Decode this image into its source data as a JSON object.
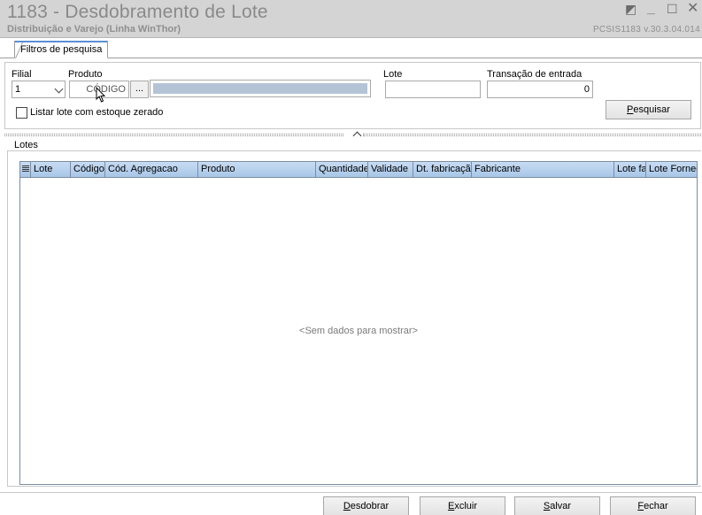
{
  "window": {
    "title": "1183 - Desdobramento de Lote",
    "subtitle": "Distribuição e Varejo (Linha WinThor)",
    "version": "PCSIS1183  v.30.3.04.014"
  },
  "tabs": [
    {
      "label": "Filtros de pesquisa"
    }
  ],
  "filters": {
    "filial_label": "Filial",
    "filial_value": "1",
    "produto_label": "Produto",
    "produto_code_placeholder": "CÓDIGO",
    "produto_lookup_label": "...",
    "lote_label": "Lote",
    "lote_value": "",
    "transacao_label": "Transação de entrada",
    "transacao_value": "0",
    "estoque_zerado_label": "Listar lote com estoque zerado",
    "estoque_zerado_checked": false,
    "pesquisar_prefix": "P",
    "pesquisar_rest": "esquisar"
  },
  "lotes": {
    "group_title": "Lotes",
    "columns": [
      "Lote",
      "Código",
      "Cód. Agregacao",
      "Produto",
      "Quantidade",
      "Validade",
      "Dt. fabricação",
      "Fabricante",
      "Lote fab",
      "Lote Fornec"
    ],
    "rows": [],
    "empty_message": "<Sem dados para mostrar>"
  },
  "actions": {
    "desdobrar_prefix": "D",
    "desdobrar_rest": "esdobrar",
    "excluir_prefix": "E",
    "excluir_rest": "xcluir",
    "salvar_prefix": "S",
    "salvar_rest": "alvar",
    "fechar_prefix": "F",
    "fechar_rest": "echar"
  },
  "colors": {
    "accent": "#5a8ed6",
    "grid_header": "#b8d0ee",
    "titlebar": "#d4d4d4"
  }
}
